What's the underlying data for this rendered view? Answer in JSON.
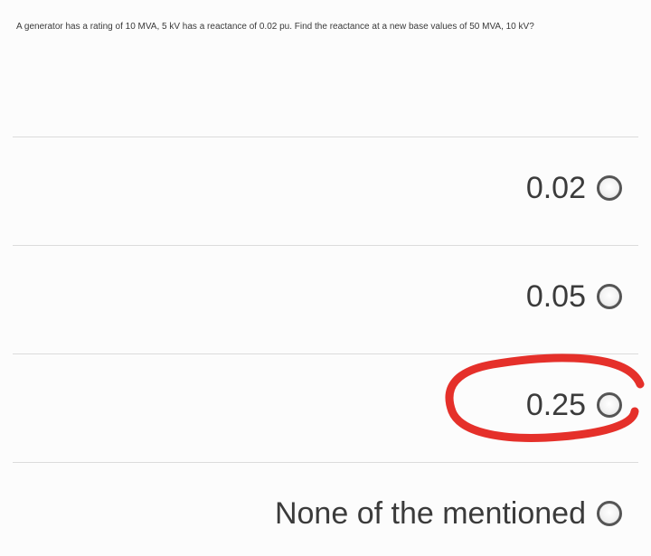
{
  "question": {
    "text": "A generator has a rating of 10 MVA, 5 kV has a reactance of 0.02 pu. Find the reactance at a new base values of 50 MVA, 10 kV?"
  },
  "options": [
    {
      "label": "0.02",
      "selected": false
    },
    {
      "label": "0.05",
      "selected": false
    },
    {
      "label": "0.25",
      "selected": false,
      "circled": true
    },
    {
      "label": "None of the mentioned",
      "selected": false
    }
  ],
  "colors": {
    "annotation": "#e5302a",
    "divider": "#dcdcdc",
    "text": "#3b3b3b",
    "radio_border": "#555555"
  }
}
